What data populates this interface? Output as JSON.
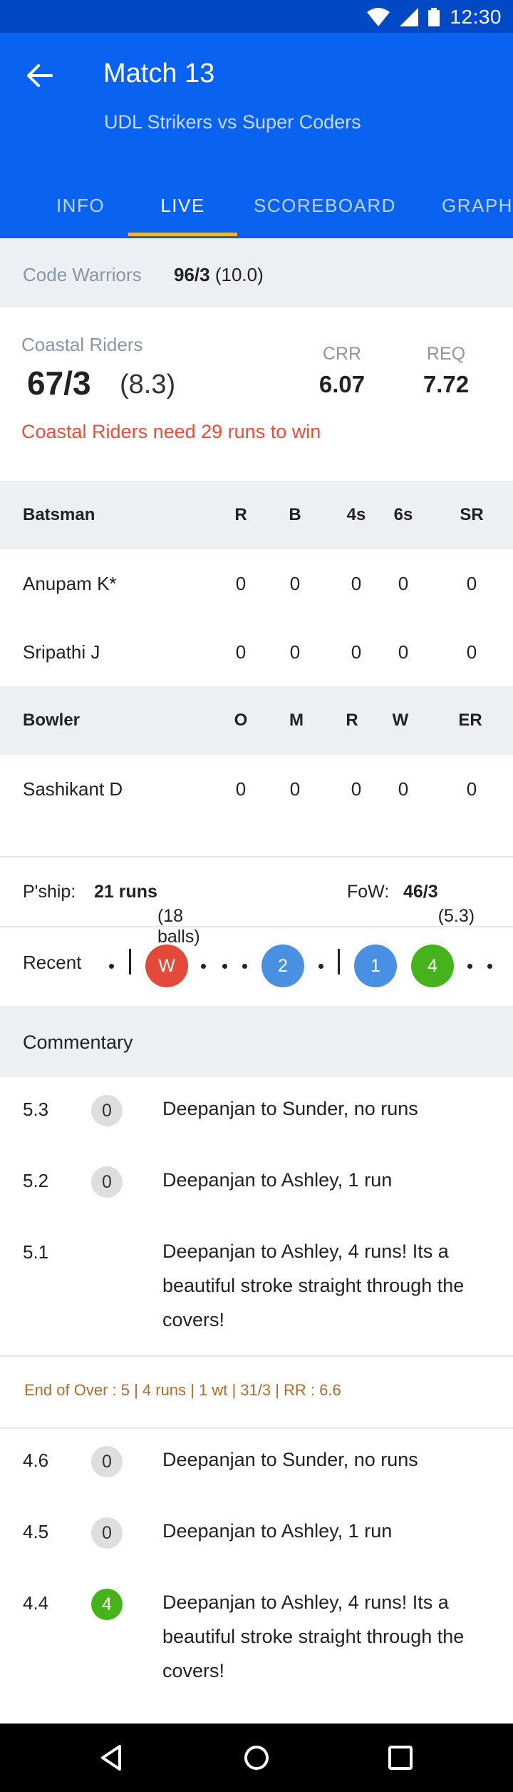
{
  "status_bar": {
    "time": "12:30"
  },
  "header": {
    "title": "Match 13",
    "subtitle": "UDL Strikers vs Super Coders",
    "tabs": [
      {
        "label": "INFO"
      },
      {
        "label": "LIVE",
        "active": true
      },
      {
        "label": "SCOREBOARD"
      },
      {
        "label": "GRAPH"
      }
    ]
  },
  "other_team": {
    "name": "Code Warriors",
    "score": "96/3",
    "overs": "(10.0)"
  },
  "batting_team": {
    "name": "Coastal Riders",
    "score": "67/3",
    "overs": "(8.3)",
    "crr_label": "CRR",
    "crr": "6.07",
    "req_label": "REQ",
    "req": "7.72",
    "need_text": "Coastal Riders need 29 runs to win"
  },
  "batsmen": {
    "headers": [
      "Batsman",
      "R",
      "B",
      "4s",
      "6s",
      "SR"
    ],
    "rows": [
      [
        "Anupam K*",
        "0",
        "0",
        "0",
        "0",
        "0"
      ],
      [
        "Sripathi J",
        "0",
        "0",
        "0",
        "0",
        "0"
      ]
    ]
  },
  "bowlers": {
    "headers": [
      "Bowler",
      "O",
      "M",
      "R",
      "W",
      "ER"
    ],
    "rows": [
      [
        "Sashikant D",
        "0",
        "0",
        "0",
        "0",
        "0"
      ]
    ]
  },
  "partnership": {
    "label": "P'ship:",
    "runs": "21 runs",
    "balls": "(18 balls)",
    "fow_label": "FoW:",
    "fow": "46/3",
    "fow_overs": "(5.3)"
  },
  "recent": {
    "label": "Recent",
    "balls": [
      {
        "value": "W",
        "color": "#e34a38"
      },
      {
        "value": "2",
        "color": "#4a90e2"
      },
      {
        "value": "1",
        "color": "#4a90e2"
      },
      {
        "value": "4",
        "color": "#47b31c"
      }
    ]
  },
  "commentary": {
    "title": "Commentary",
    "items_a": [
      {
        "over": "5.3",
        "runs": "0",
        "text": "Deepanjan to Sunder, no runs"
      },
      {
        "over": "5.2",
        "runs": "0",
        "text": "Deepanjan to Ashley, 1 run"
      },
      {
        "over": "5.1",
        "runs": "",
        "text": "Deepanjan to Ashley, 4 runs! Its a beautiful stroke straight through the covers!"
      }
    ],
    "end_of_over": "End of Over : 5 | 4 runs  | 1 wt | 31/3 | RR : 6.6",
    "items_b": [
      {
        "over": "4.6",
        "runs": "0",
        "text": "Deepanjan to Sunder, no runs"
      },
      {
        "over": "4.5",
        "runs": "0",
        "text": "Deepanjan to Ashley, 1 run"
      },
      {
        "over": "4.4",
        "runs": "4",
        "text": "Deepanjan to Ashley, 4 runs! Its a beautiful stroke straight through the covers!"
      }
    ]
  }
}
